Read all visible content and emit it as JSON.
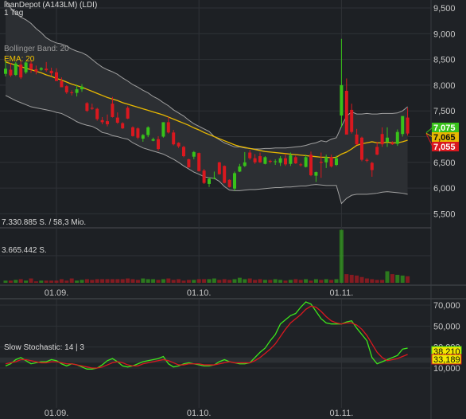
{
  "header": {
    "instrument": "loanDepot (A143LM) (LDI)",
    "period": "1 Tag",
    "bollinger_label": "Bollinger Band: 20",
    "ema_label": "EMA: 20"
  },
  "volume_labels": {
    "max": "7.330.885 S. / 58,3 Mio.",
    "mid": "3.665.442 S."
  },
  "stoch_label": "Slow Stochastic: 14 | 3",
  "colors": {
    "background": "#1f2226",
    "up": "#38c21a",
    "down": "#d9181f",
    "ema": "#e8b800",
    "bands": "#a0a0a0",
    "stoch_k": "#3ee61c",
    "stoch_d": "#d9181f"
  },
  "chart_data": [
    {
      "type": "candlestick",
      "title": "loanDepot (A143LM) (LDI)",
      "ylim": [
        5600,
        9600
      ],
      "yticks": [
        "9,500",
        "9,000",
        "8,500",
        "8,000",
        "7,500",
        "7,000",
        "6,500",
        "6,000",
        "5,500"
      ],
      "ytick_values": [
        9500,
        9000,
        8500,
        8000,
        7500,
        7000,
        6500,
        6000,
        5500
      ],
      "xticks": [
        "01.09.",
        "01.10.",
        "01.11."
      ],
      "xtick_index": [
        10,
        38,
        66
      ],
      "candles": [
        [
          8220,
          8470,
          8170,
          8320
        ],
        [
          8300,
          8430,
          8160,
          8190
        ],
        [
          8200,
          8450,
          8180,
          8420
        ],
        [
          8400,
          8470,
          8120,
          8150
        ],
        [
          8250,
          8460,
          8220,
          8440
        ],
        [
          8420,
          8480,
          8240,
          8310
        ],
        [
          8310,
          8380,
          8210,
          8260
        ],
        [
          8300,
          8350,
          8280,
          8330
        ],
        [
          8320,
          8450,
          8260,
          8290
        ],
        [
          8280,
          8340,
          8180,
          8230
        ],
        [
          8250,
          8330,
          8140,
          8080
        ],
        [
          8080,
          8150,
          7970,
          7960
        ],
        [
          7980,
          8000,
          7830,
          7860
        ],
        [
          7860,
          7900,
          7800,
          7850
        ],
        [
          7850,
          8010,
          7780,
          7920
        ],
        [
          7920,
          8020,
          7870,
          7970
        ],
        [
          7650,
          7670,
          7480,
          7500
        ],
        [
          7560,
          7640,
          7520,
          7540
        ],
        [
          7540,
          7560,
          7310,
          7340
        ],
        [
          7320,
          7380,
          7240,
          7280
        ],
        [
          7300,
          7430,
          7200,
          7240
        ],
        [
          7640,
          7770,
          7370,
          7380
        ],
        [
          7370,
          7470,
          7250,
          7270
        ],
        [
          7260,
          7280,
          7150,
          7160
        ],
        [
          7560,
          7590,
          7340,
          7350
        ],
        [
          7180,
          7200,
          7000,
          7010
        ],
        [
          7160,
          7180,
          6950,
          6980
        ],
        [
          6960,
          7050,
          6900,
          7030
        ],
        [
          7030,
          7200,
          6990,
          7180
        ],
        [
          6920,
          6980,
          6910,
          6950
        ],
        [
          6950,
          7010,
          6730,
          6760
        ],
        [
          7000,
          7280,
          6980,
          7280
        ],
        [
          7280,
          7380,
          7060,
          7080
        ],
        [
          7080,
          7130,
          6830,
          6850
        ],
        [
          6880,
          6890,
          6780,
          6810
        ],
        [
          6800,
          6820,
          6600,
          6620
        ],
        [
          6560,
          6570,
          6400,
          6400
        ],
        [
          6610,
          6720,
          6560,
          6700
        ],
        [
          6680,
          6690,
          6320,
          6330
        ],
        [
          6340,
          6370,
          6080,
          6100
        ],
        [
          6080,
          6210,
          6020,
          6180
        ],
        [
          6180,
          6320,
          6170,
          6200
        ],
        [
          6500,
          6510,
          6260,
          6270
        ],
        [
          6430,
          6440,
          6090,
          6100
        ],
        [
          6160,
          6170,
          6010,
          6020
        ],
        [
          5990,
          6320,
          5950,
          6290
        ],
        [
          6320,
          6470,
          6310,
          6420
        ],
        [
          6430,
          6700,
          6410,
          6500
        ],
        [
          6690,
          6740,
          6550,
          6580
        ],
        [
          6580,
          6660,
          6470,
          6500
        ],
        [
          6620,
          6690,
          6490,
          6500
        ],
        [
          6470,
          6620,
          6460,
          6600
        ],
        [
          6530,
          6550,
          6480,
          6510
        ],
        [
          6510,
          6560,
          6450,
          6520
        ],
        [
          6490,
          6620,
          6430,
          6580
        ],
        [
          6580,
          6670,
          6430,
          6460
        ],
        [
          6470,
          6690,
          6430,
          6640
        ],
        [
          6600,
          6630,
          6470,
          6480
        ],
        [
          6460,
          6490,
          6420,
          6450
        ],
        [
          6410,
          6650,
          6400,
          6600
        ],
        [
          6650,
          6710,
          6230,
          6250
        ],
        [
          6240,
          6320,
          6120,
          6310
        ],
        [
          6510,
          6690,
          6200,
          6490
        ],
        [
          6500,
          6650,
          6390,
          6600
        ],
        [
          6600,
          6650,
          6400,
          6420
        ],
        [
          6450,
          6630,
          6430,
          6580
        ],
        [
          7410,
          8900,
          7180,
          8000
        ],
        [
          7890,
          8130,
          7060,
          7040
        ],
        [
          7520,
          7640,
          7060,
          7090
        ],
        [
          7040,
          7150,
          6840,
          6850
        ],
        [
          6980,
          7000,
          6520,
          6550
        ],
        [
          6550,
          6580,
          6500,
          6530
        ],
        [
          6490,
          6510,
          6220,
          6350
        ],
        [
          6800,
          6900,
          6640,
          6650
        ],
        [
          7050,
          7180,
          6800,
          6850
        ],
        [
          6900,
          7180,
          6800,
          6980
        ],
        [
          6880,
          6910,
          6840,
          6850
        ],
        [
          6860,
          7140,
          6820,
          7090
        ],
        [
          7050,
          7300,
          7000,
          7400
        ],
        [
          7370,
          7560,
          7020,
          7060
        ]
      ],
      "ema_values": [
        8450,
        8420,
        8390,
        8360,
        8330,
        8300,
        8270,
        8240,
        8200,
        8170,
        8130,
        8100,
        8060,
        8020,
        7990,
        7960,
        7920,
        7880,
        7840,
        7800,
        7760,
        7730,
        7700,
        7660,
        7630,
        7600,
        7570,
        7540,
        7510,
        7480,
        7450,
        7420,
        7380,
        7340,
        7300,
        7260,
        7220,
        7170,
        7130,
        7080,
        7040,
        7000,
        6960,
        6920,
        6880,
        6840,
        6810,
        6790,
        6770,
        6750,
        6730,
        6710,
        6700,
        6690,
        6680,
        6670,
        6660,
        6650,
        6640,
        6630,
        6620,
        6610,
        6600,
        6600,
        6590,
        6600,
        6660,
        6700,
        6760,
        6830,
        6860,
        6880,
        6900,
        6880,
        6880,
        6890,
        6880,
        6880,
        6900,
        6930
      ],
      "bb_upper": [
        9640,
        9500,
        9400,
        9320,
        9270,
        9200,
        9100,
        9020,
        8920,
        8860,
        8820,
        8800,
        8760,
        8700,
        8660,
        8630,
        8580,
        8500,
        8420,
        8350,
        8300,
        8260,
        8210,
        8140,
        8080,
        8010,
        7960,
        7900,
        7850,
        7780,
        7730,
        7660,
        7600,
        7520,
        7460,
        7400,
        7320,
        7250,
        7200,
        7150,
        7100,
        7000,
        6940,
        6880,
        6840,
        6800,
        6800,
        6780,
        6770,
        6760,
        6760,
        6770,
        6770,
        6780,
        6780,
        6780,
        6790,
        6800,
        6810,
        6830,
        6860,
        6880,
        6920,
        6900,
        6950,
        6980,
        7200,
        7400,
        7480,
        7440,
        7440,
        7450,
        7440,
        7440,
        7450,
        7450,
        7450,
        7460,
        7500,
        7580
      ],
      "bb_lower": [
        7800,
        7750,
        7700,
        7660,
        7620,
        7580,
        7560,
        7540,
        7520,
        7500,
        7470,
        7450,
        7400,
        7350,
        7290,
        7250,
        7220,
        7200,
        7150,
        7080,
        7060,
        7020,
        7000,
        6970,
        6950,
        6880,
        6830,
        6780,
        6750,
        6720,
        6690,
        6660,
        6610,
        6560,
        6500,
        6430,
        6370,
        6310,
        6270,
        6220,
        6200,
        6190,
        6130,
        6030,
        5960,
        5950,
        5950,
        5960,
        5970,
        5970,
        5980,
        5990,
        6000,
        6010,
        6010,
        6020,
        6020,
        6030,
        6040,
        6040,
        6060,
        6070,
        6060,
        6050,
        6050,
        6050,
        5700,
        5800,
        5860,
        5880,
        5880,
        5880,
        5890,
        5900,
        5920,
        5930,
        5920,
        5910,
        5900,
        5880
      ],
      "last_prices": [
        {
          "label": "7,075",
          "value": 7075,
          "color": "#38c21a"
        },
        {
          "label": "7,065",
          "value": 7065,
          "color": "#e8b800"
        },
        {
          "label": "7,055",
          "value": 7055,
          "color": "#d9181f"
        }
      ]
    },
    {
      "type": "bar",
      "title": "Volume",
      "values": [
        0.3,
        0.3,
        0.4,
        0.5,
        0.3,
        0.6,
        0.2,
        0.3,
        0.3,
        0.3,
        0.3,
        0.5,
        0.3,
        0.6,
        0.3,
        0.4,
        0.5,
        0.4,
        0.5,
        0.5,
        0.5,
        0.5,
        0.5,
        0.5,
        0.6,
        0.5,
        0.4,
        0.6,
        0.5,
        0.5,
        0.4,
        0.5,
        0.6,
        0.4,
        0.5,
        0.3,
        0.4,
        0.4,
        0.5,
        0.5,
        0.5,
        0.6,
        0.4,
        0.5,
        0.4,
        0.5,
        0.7,
        0.5,
        0.6,
        0.4,
        0.5,
        0.4,
        0.4,
        0.5,
        0.4,
        0.3,
        0.4,
        0.5,
        0.4,
        0.5,
        0.3,
        0.5,
        0.4,
        0.5,
        0.4,
        0.5,
        7.33,
        1.2,
        1.1,
        1.0,
        0.8,
        0.6,
        0.5,
        0.4,
        0.4,
        1.6,
        1.2,
        1.1,
        1.0,
        0.9
      ],
      "ylim": [
        0,
        7.5
      ]
    },
    {
      "type": "line",
      "title": "Slow Stochastic: 14 | 3",
      "yticks": [
        "70,000",
        "50,000",
        "30,000",
        "10,000"
      ],
      "ytick_values": [
        70,
        50,
        30,
        10
      ],
      "ylim": [
        4,
        72
      ],
      "xticks": [
        "01.09.",
        "01.10.",
        "01.11."
      ],
      "xtick_index": [
        10,
        38,
        66
      ],
      "series": [
        {
          "name": "%K",
          "values": [
            12,
            14,
            18,
            20,
            17,
            14,
            15,
            16,
            16,
            18,
            17,
            14,
            12,
            14,
            13,
            11,
            9,
            9,
            10,
            13,
            17,
            19,
            16,
            12,
            11,
            12,
            14,
            16,
            17,
            18,
            19,
            21,
            14,
            11,
            12,
            14,
            15,
            14,
            13,
            12,
            12,
            13,
            16,
            18,
            16,
            15,
            14,
            14,
            15,
            20,
            25,
            29,
            36,
            42,
            52,
            56,
            60,
            62,
            68,
            73,
            71,
            64,
            57,
            53,
            52,
            52,
            52,
            54,
            55,
            48,
            42,
            36,
            20,
            14,
            16,
            18,
            20,
            22,
            28,
            29
          ]
        },
        {
          "name": "%D",
          "values": [
            14,
            15,
            16,
            18,
            18,
            17,
            16,
            15,
            15,
            16,
            16,
            15,
            14,
            14,
            13,
            12,
            11,
            10,
            10,
            11,
            13,
            15,
            16,
            15,
            13,
            12,
            12,
            14,
            15,
            16,
            17,
            18,
            17,
            15,
            13,
            13,
            14,
            14,
            14,
            13,
            13,
            13,
            14,
            15,
            16,
            15,
            15,
            15,
            15,
            17,
            20,
            24,
            28,
            33,
            40,
            47,
            53,
            57,
            61,
            66,
            69,
            68,
            64,
            59,
            55,
            53,
            52,
            53,
            53,
            51,
            47,
            41,
            33,
            25,
            20,
            17,
            18,
            19,
            21,
            23
          ]
        }
      ],
      "last_values": [
        {
          "label": "38,210",
          "value": 38.21,
          "color": "#3ee61c"
        },
        {
          "label": "33,189",
          "value": 33.189,
          "color": "#d9181f"
        }
      ]
    }
  ]
}
